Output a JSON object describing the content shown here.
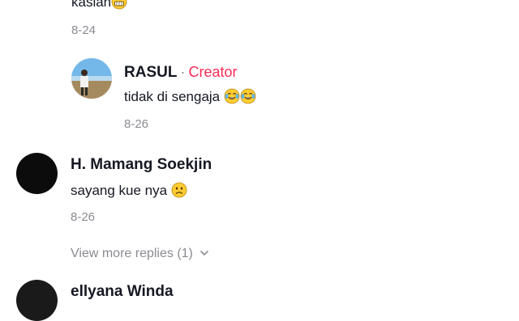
{
  "comments": {
    "top_partial": {
      "text": "kasian",
      "emoji": "grinning-face-icon",
      "date": "8-24"
    },
    "reply": {
      "author": "RASUL",
      "separator": "·",
      "badge": "Creator",
      "text": "tidak di sengaja",
      "emojis": [
        "tears-of-joy-icon",
        "tears-of-joy-icon"
      ],
      "date": "8-26"
    },
    "comment2": {
      "author": "H. Mamang Soekjin",
      "text": "sayang kue nya",
      "emoji": "frowning-face-icon",
      "date": "8-26",
      "view_more": "View more replies (1)"
    },
    "bottom_partial": {
      "author": "ellyana Winda"
    }
  },
  "colors": {
    "text": "#161823",
    "muted": "#8a8b91",
    "creator": "#fe2c55"
  }
}
